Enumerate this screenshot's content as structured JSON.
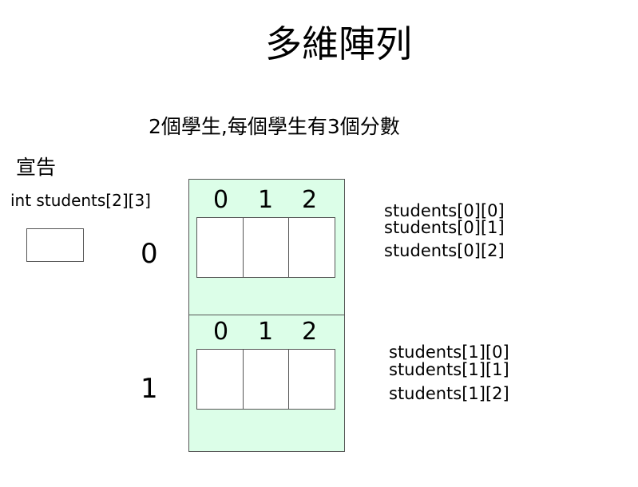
{
  "title": "多維陣列",
  "subtitle": "2個學生,每個學生有3個分數",
  "declaration": {
    "label": "宣告",
    "code": "int students[2][3]"
  },
  "rows": [
    {
      "index": "0",
      "columns": [
        "0",
        "1",
        "2"
      ],
      "elements": [
        "students[0][0]",
        "students[0][1]",
        "students[0][2]"
      ]
    },
    {
      "index": "1",
      "columns": [
        "0",
        "1",
        "2"
      ],
      "elements": [
        "students[1][0]",
        "students[1][1]",
        "students[1][2]"
      ]
    }
  ],
  "colors": {
    "block_fill": "#dcfee8",
    "border": "#555555"
  }
}
